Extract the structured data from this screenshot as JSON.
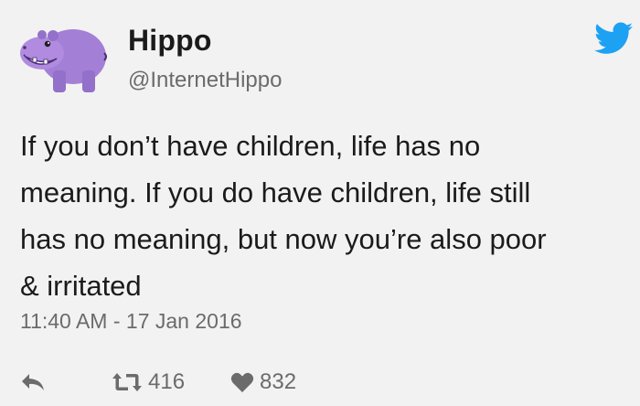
{
  "author": {
    "name": "Hippo",
    "handle": "@InternetHippo"
  },
  "tweet": {
    "text": "If you don’t have children, life has no\nmeaning. If you do have children, life still\nhas no meaning, but now you’re also poor\n& irritated",
    "timestamp": "11:40 AM - 17 Jan 2016"
  },
  "stats": {
    "retweets": "416",
    "likes": "832"
  },
  "icons": {
    "avatar": "purple-hippo-avatar",
    "brand": "twitter-bird-icon",
    "reply": "reply-arrow-icon",
    "retweet": "retweet-icon",
    "like": "heart-icon"
  },
  "colors": {
    "background": "#f2f2f2",
    "text": "#1b1b1b",
    "muted": "#6b6b6b",
    "twitter_blue": "#1da1f2",
    "hippo_purple": "#a47fd6"
  }
}
